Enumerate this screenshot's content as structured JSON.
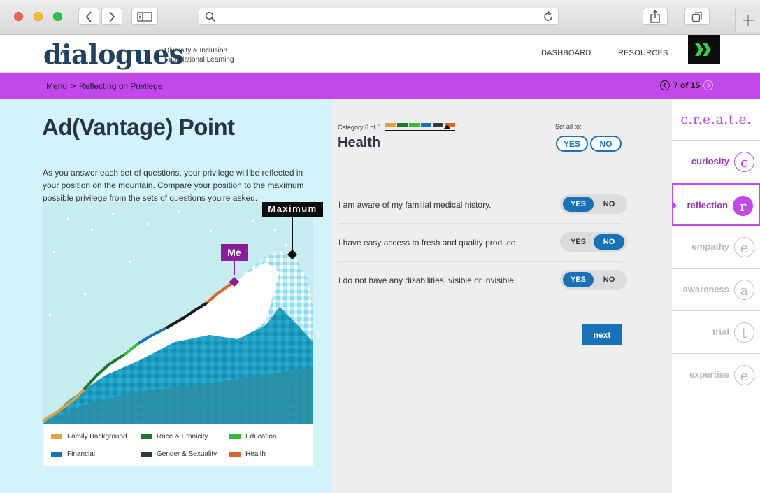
{
  "site": {
    "logo": "dialogues",
    "tagline_line1": "Diversity & Inclusion",
    "tagline_line2": "Foundational Learning",
    "nav": [
      "DASHBOARD",
      "RESOURCES"
    ]
  },
  "breadcrumb": {
    "menu": "Menu",
    "separator": ">",
    "current": "Reflecting on Privilege",
    "page_indicator": "7 of 15"
  },
  "activity": {
    "title": "Ad(Vantage) Point",
    "intro": "As you answer each set of questions, your privilege will be reflected in your position on the mountain. Compare your position to the maximum possible privilege from the sets of questions you're asked.",
    "marker_max": "Maximum",
    "marker_me": "Me",
    "legend": [
      {
        "label": "Family Background",
        "color": "#e0a23a"
      },
      {
        "label": "Race & Ethnicity",
        "color": "#1b7a2c"
      },
      {
        "label": "Education",
        "color": "#2ec02e"
      },
      {
        "label": "Financial",
        "color": "#1872b8"
      },
      {
        "label": "Gender & Sexuality",
        "color": "#2c3a45"
      },
      {
        "label": "Health",
        "color": "#e0622a"
      }
    ]
  },
  "questions_panel": {
    "category_label": "Category 6 of 6",
    "category_name": "Health",
    "set_all_label": "Set all to:",
    "yes_label": "YES",
    "no_label": "NO",
    "next_label": "next",
    "questions": [
      {
        "text": "I am aware of my familial medical history.",
        "answer": "YES"
      },
      {
        "text": "I have easy access to fresh and quality produce.",
        "answer": "NO"
      },
      {
        "text": "I do not have any disabilities, visible or invisible.",
        "answer": "YES"
      }
    ]
  },
  "sidebar": {
    "heading": "c.r.e.a.t.e.",
    "steps": [
      {
        "label": "curiosity",
        "letter": "c",
        "state": "done"
      },
      {
        "label": "reflection",
        "letter": "r",
        "state": "current"
      },
      {
        "label": "empathy",
        "letter": "e",
        "state": "todo"
      },
      {
        "label": "awareness",
        "letter": "a",
        "state": "todo"
      },
      {
        "label": "trial",
        "letter": "t",
        "state": "todo"
      },
      {
        "label": "expertise",
        "letter": "e",
        "state": "todo"
      }
    ]
  }
}
